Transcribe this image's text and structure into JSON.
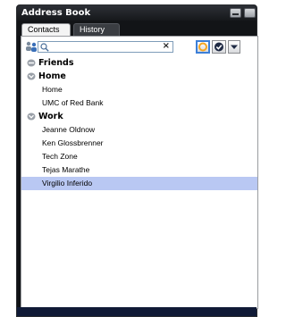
{
  "window": {
    "title": "Address Book"
  },
  "tabs": [
    {
      "label": "Contacts",
      "active": true
    },
    {
      "label": "History",
      "active": false
    }
  ],
  "toolbar": {
    "search_value": "",
    "clear_glyph": "×",
    "status_color": "#f5a623"
  },
  "tree": {
    "groups": [
      {
        "name": "Friends",
        "expanded": false,
        "contacts": []
      },
      {
        "name": "Home",
        "expanded": true,
        "contacts": [
          "Home",
          "UMC of Red Bank"
        ]
      },
      {
        "name": "Work",
        "expanded": true,
        "contacts": [
          "Jeanne Oldnow",
          "Ken Glossbrenner",
          "Tech Zone",
          "Tejas Marathe",
          "Virgilio Inferido"
        ]
      }
    ],
    "selected_contact": "Virgilio Inferido"
  },
  "colors": {
    "selection": "#b9c8f3",
    "titlebar": "#16181b",
    "accent": "#3c7fd8"
  }
}
